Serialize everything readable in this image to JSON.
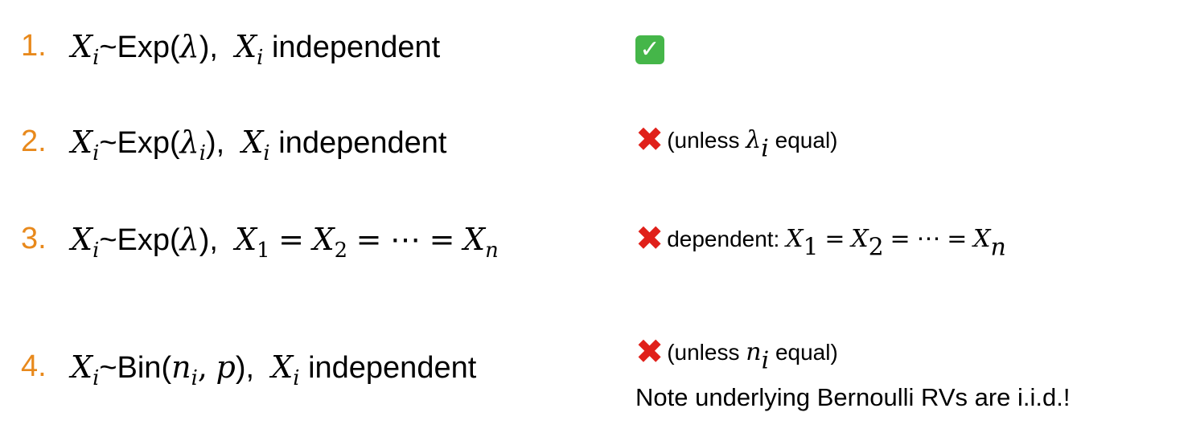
{
  "items": [
    {
      "number": "1.",
      "var": "X",
      "var_sub": "i",
      "dist": "~Exp(",
      "param": "λ",
      "param_sub": "",
      "close": "),",
      "var2": "X",
      "var2_sub": "i",
      "condition": " independent",
      "verdict": "check"
    },
    {
      "number": "2.",
      "var": "X",
      "var_sub": "i",
      "dist": "~Exp(",
      "param": "λ",
      "param_sub": "i",
      "close": "),",
      "var2": "X",
      "var2_sub": "i",
      "condition": " independent",
      "verdict": "cross",
      "note_pre": "(unless ",
      "note_var": "λ",
      "note_sub": "i",
      "note_post": " equal)"
    },
    {
      "number": "3.",
      "var": "X",
      "var_sub": "i",
      "dist": "~Exp(",
      "param": "λ",
      "close": "),",
      "chain": [
        "X",
        "1",
        "=",
        "X",
        "2",
        "=",
        "⋯",
        "=",
        "X",
        "n"
      ],
      "verdict": "cross",
      "note_pre": "dependent: ",
      "note_chain": [
        "X",
        "1",
        "=",
        "X",
        "2",
        "=",
        "⋯",
        "=",
        "X",
        "n"
      ]
    },
    {
      "number": "4.",
      "var": "X",
      "var_sub": "i",
      "dist": "~Bin(",
      "param": "n",
      "param_sub": "i",
      "param2": "p",
      "close": "),",
      "var2": "X",
      "var2_sub": "i",
      "condition": " independent",
      "verdict": "cross",
      "note_pre": "(unless ",
      "note_var": "n",
      "note_sub": "i",
      "note_post": " equal)",
      "note_line2": "Note underlying Bernoulli RVs are i.i.d.!"
    }
  ],
  "icons": {
    "check": "check-mark-icon",
    "cross": "cross-mark-icon"
  },
  "colors": {
    "number": "#e8891c",
    "check_bg": "#45b649",
    "cross": "#e0201a"
  }
}
